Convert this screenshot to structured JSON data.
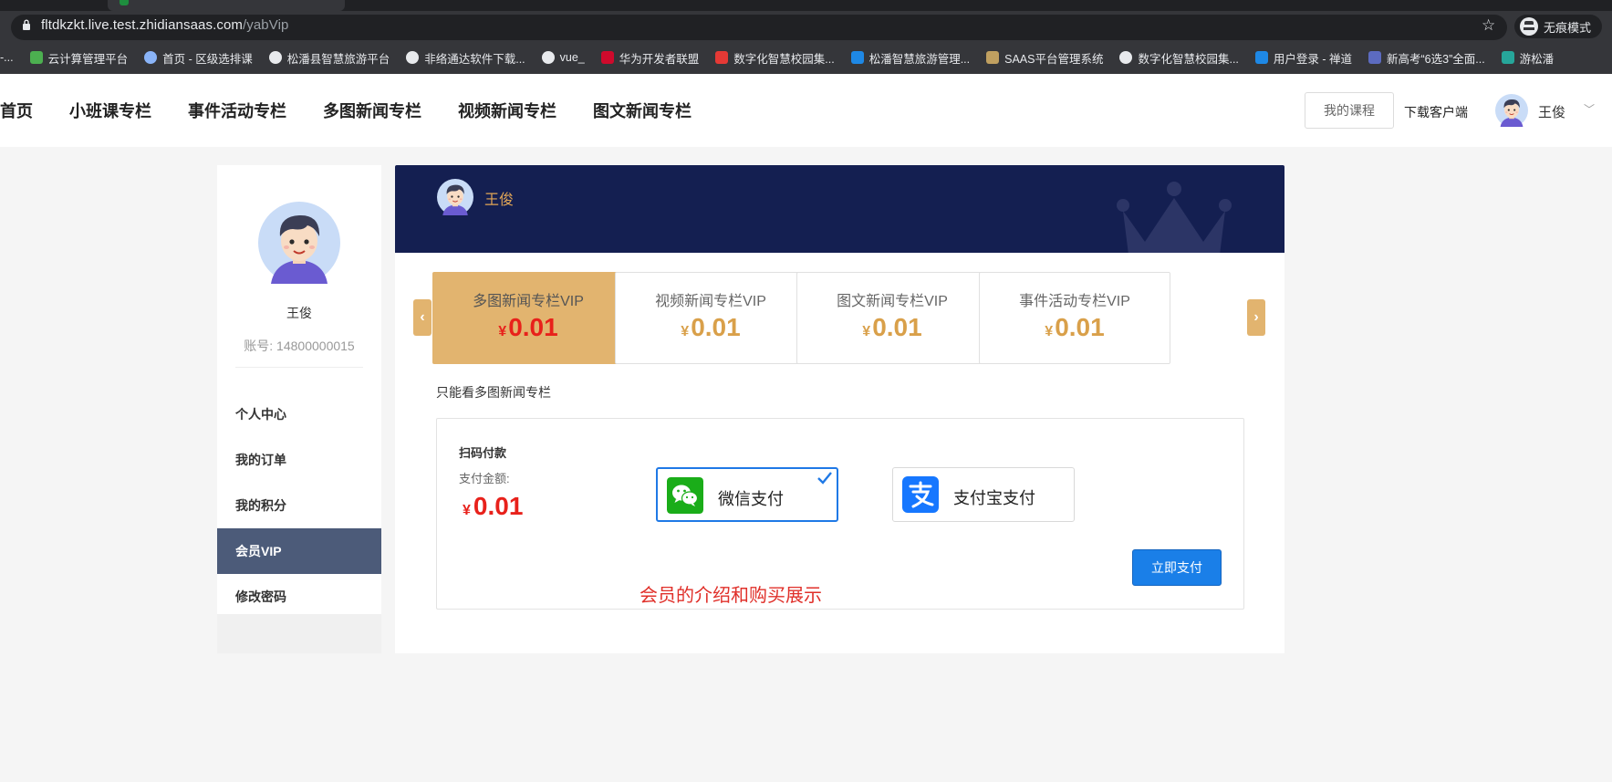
{
  "browser": {
    "url_host": "fltdkzkt.live.test.zhidiansaas.com",
    "url_path": "/yabVip",
    "incognito_label": "无痕模式",
    "bookmarks": [
      {
        "label": "-...",
        "icon": "none",
        "color": "#35363a"
      },
      {
        "label": "云计算管理平台",
        "icon": "cloud-icon",
        "color": "#4caf50"
      },
      {
        "label": "首页 - 区级选排课",
        "icon": "globe-icon",
        "color": "#8ab4f8"
      },
      {
        "label": "松潘县智慧旅游平台",
        "icon": "globe-icon",
        "color": "#e8eaed"
      },
      {
        "label": "非络通达软件下载...",
        "icon": "globe-icon",
        "color": "#e8eaed"
      },
      {
        "label": "vue_",
        "icon": "globe-icon",
        "color": "#e8eaed"
      },
      {
        "label": "华为开发者联盟",
        "icon": "huawei-icon",
        "color": "#cf0a2c"
      },
      {
        "label": "数字化智慧校园集...",
        "icon": "campus-icon",
        "color": "#e53935"
      },
      {
        "label": "松潘智慧旅游管理...",
        "icon": "tc-icon",
        "color": "#1e88e5"
      },
      {
        "label": "SAAS平台管理系统",
        "icon": "saas-icon",
        "color": "#c0a060"
      },
      {
        "label": "数字化智慧校园集...",
        "icon": "globe-icon",
        "color": "#e8eaed"
      },
      {
        "label": "用户登录 - 禅道",
        "icon": "zentao-icon",
        "color": "#1e88e5"
      },
      {
        "label": "新高考“6选3”全面...",
        "icon": "grid-icon",
        "color": "#5c6bc0"
      },
      {
        "label": "游松潘",
        "icon": "leaf-icon",
        "color": "#26a69a"
      }
    ]
  },
  "header": {
    "nav": [
      "首页",
      "小班课专栏",
      "事件活动专栏",
      "多图新闻专栏",
      "视频新闻专栏",
      "图文新闻专栏"
    ],
    "my_courses": "我的课程",
    "download_client": "下载客户端",
    "user_name": "王俊",
    "chevron": "﹀"
  },
  "sidebar": {
    "name": "王俊",
    "account": "账号: 14800000015",
    "menu": [
      "个人中心",
      "我的订单",
      "我的积分",
      "会员VIP",
      "修改密码"
    ],
    "active_index": 3
  },
  "banner": {
    "user_name": "王俊"
  },
  "vip_plans": [
    {
      "name": "多图新闻专栏VIP",
      "currency": "¥",
      "price": "0.01",
      "selected": true
    },
    {
      "name": "视频新闻专栏VIP",
      "currency": "¥",
      "price": "0.01",
      "selected": false
    },
    {
      "name": "图文新闻专栏VIP",
      "currency": "¥",
      "price": "0.01",
      "selected": false
    },
    {
      "name": "事件活动专栏VIP",
      "currency": "¥",
      "price": "0.01",
      "selected": false
    }
  ],
  "vip_description": "只能看多图新闻专栏",
  "payment": {
    "title": "扫码付款",
    "amount_label": "支付金额:",
    "currency": "¥",
    "amount": "0.01",
    "options": [
      {
        "label": "微信支付",
        "icon": "wechat-icon",
        "selected": true
      },
      {
        "label": "支付宝支付",
        "icon": "alipay-icon",
        "selected": false
      }
    ],
    "pay_button": "立即支付"
  },
  "annotation": "会员的介绍和购买展示",
  "colors": {
    "accent_gold": "#e2b46f",
    "price_red": "#e8211b",
    "banner_navy": "#141f51",
    "menu_active": "#4c5b79",
    "primary_blue": "#1a7fe8"
  }
}
